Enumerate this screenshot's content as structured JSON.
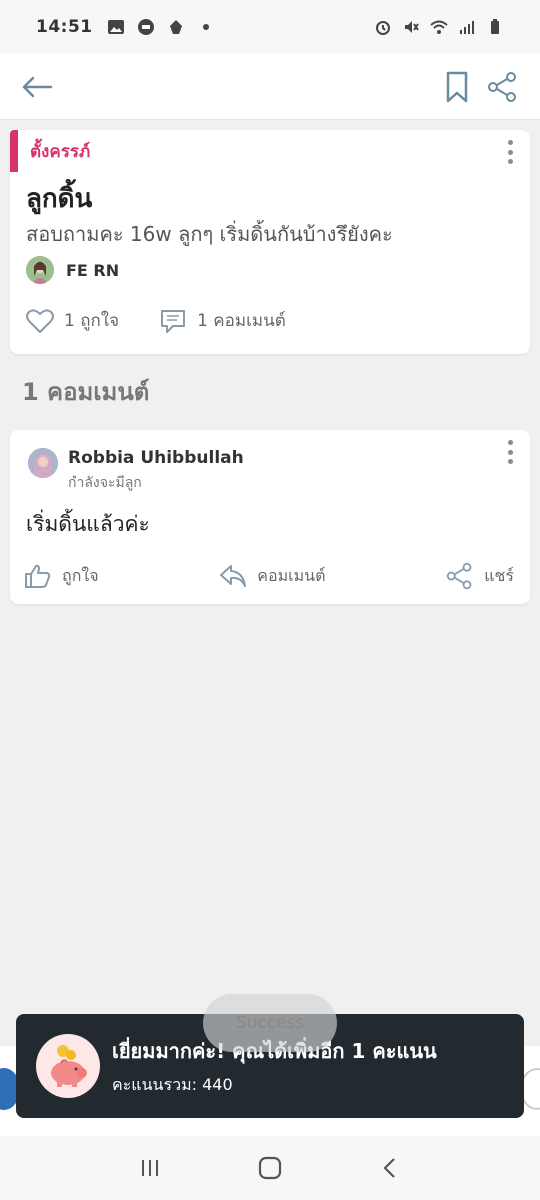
{
  "status_bar": {
    "time": "14:51",
    "left_icons": [
      "gallery-icon",
      "line-icon",
      "app-icon",
      "dot-icon"
    ],
    "right_icons": [
      "alarm-icon",
      "mute-icon",
      "wifi-icon",
      "signal-icon",
      "battery-icon"
    ]
  },
  "app_bar": {
    "back_icon": "back-arrow-icon",
    "bookmark_icon": "bookmark-icon",
    "share_icon": "share-icon"
  },
  "post": {
    "category": "ตั้งครรภ์",
    "title": "ลูกดิ้น",
    "body": "สอบถามคะ 16w ลูกๆ เริ่มดิ้นกันบ้างรึยังคะ",
    "author": "FE RN",
    "likes_label": "1 ถูกใจ",
    "comments_label": "1 คอมเมนต์"
  },
  "comments_section": {
    "title": "1 คอมเมนต์"
  },
  "comment": {
    "author": "Robbia Uhibbullah",
    "status": "กำลังจะมีลูก",
    "text": "เริ่มดิ้นแล้วค่ะ",
    "like_label": "ถูกใจ",
    "reply_label": "คอมเมนต์",
    "share_label": "แชร์"
  },
  "toast": {
    "title": "เยี่ยมมากค่ะ! คุณได้เพิ่มอีก 1 คะแนน",
    "subtitle": "คะแนนรวม: 440",
    "icon": "piggy-bank-icon"
  },
  "success_pill": {
    "text": "Success"
  },
  "nav_bar": {
    "icons": [
      "recent-apps-icon",
      "home-icon",
      "back-icon"
    ]
  },
  "colors": {
    "accent": "#d6336c",
    "toast_bg": "#222a30",
    "background": "#f0f0f0"
  }
}
